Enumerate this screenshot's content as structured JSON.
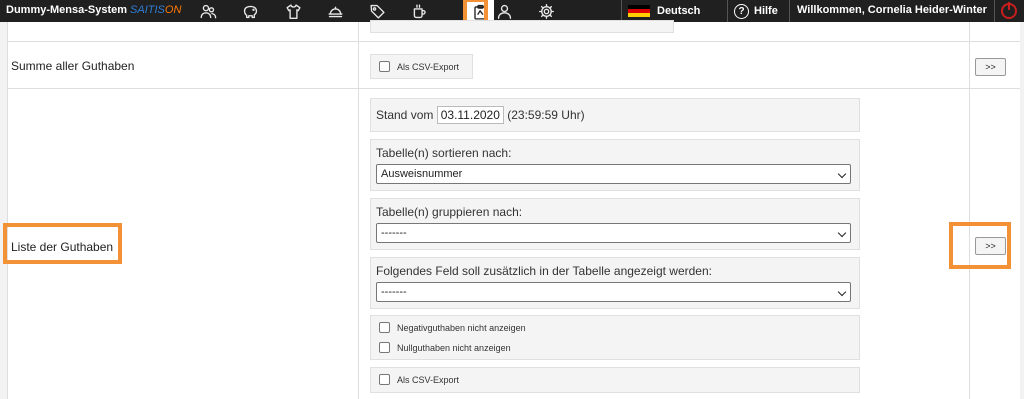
{
  "header": {
    "app_name": "Dummy-Mensa-System",
    "logo_part1": "SAITIS",
    "logo_part2": "ON",
    "nav_icons": [
      "persons-icon",
      "piggy-bank-icon",
      "shirt-icon",
      "dish-icon",
      "tag-icon",
      "coffee-cup-icon",
      "clipboard-icon",
      "user-icon",
      "settings-icon"
    ],
    "active_icon": "clipboard-icon",
    "language": "Deutsch",
    "help": "Hilfe",
    "welcome": "Willkommen, Cornelia Heider-Winter",
    "colors": {
      "bar": "#202020",
      "highlight": "#f39136",
      "flag_black": "#000000",
      "flag_red": "#dd0000",
      "flag_gold": "#ffce00",
      "power": "#c81e1e"
    }
  },
  "rows": {
    "summe": {
      "label": "Summe aller Guthaben",
      "csv_label": "Als CSV-Export",
      "button": ">>"
    },
    "liste": {
      "label": "Liste der Guthaben",
      "stand_prefix": "Stand vom",
      "stand_date": "03.11.2020",
      "stand_suffix": "(23:59:59 Uhr)",
      "sort_label": "Tabelle(n) sortieren nach:",
      "sort_value": "Ausweisnummer",
      "group_label": "Tabelle(n) gruppieren nach:",
      "group_value": "-------",
      "extra_label": "Folgendes Feld soll zusätzlich in der Tabelle angezeigt werden:",
      "extra_value": "-------",
      "neg_label": "Negativguthaben nicht anzeigen",
      "null_label": "Nullguthaben nicht anzeigen",
      "csv_label": "Als CSV-Export",
      "button": ">>"
    }
  }
}
